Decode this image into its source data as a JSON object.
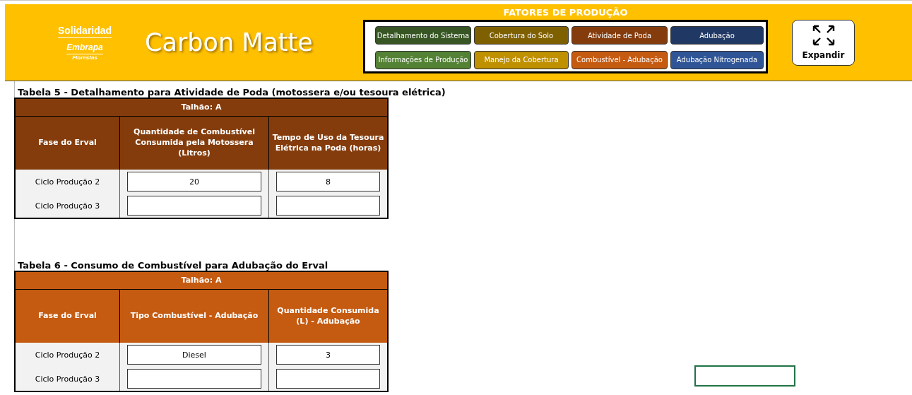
{
  "header": {
    "logo": {
      "top": "Solidaridad",
      "middle": "Embrapa",
      "bottom": "Florestas"
    },
    "title": "Carbon Matte",
    "nav": {
      "title": "FATORES DE PRODUÇÃO",
      "buttons": [
        {
          "label": "Detalhamento do Sistema",
          "color": "#375623"
        },
        {
          "label": "Cobertura do Solo",
          "color": "#7f6000"
        },
        {
          "label": "Atividade de Poda",
          "color": "#843c0c"
        },
        {
          "label": "Adubação",
          "color": "#203864"
        },
        {
          "label": "Informações de Produção",
          "color": "#548235"
        },
        {
          "label": "Manejo da Cobertura",
          "color": "#bf9000"
        },
        {
          "label": "Combustível - Adubação",
          "color": "#c55a11"
        },
        {
          "label": "Adubação Nitrogenada",
          "color": "#2f5597"
        }
      ]
    },
    "expand_button": {
      "label": "Expandir"
    }
  },
  "tables": [
    {
      "title": "Tabela 5 -  Detalhamento para Atividade de Poda (motossera e/ou tesoura elétrica)",
      "color": "#843c0c",
      "band": "Talhão: A",
      "columns": [
        "Fase do Erval",
        "Quantidade de Combustível Consumida pela Motossera (Litros)",
        "Tempo de Uso da Tesoura Elétrica na Poda (horas)"
      ],
      "rows": [
        {
          "phase": "Ciclo Produção 2",
          "fields": [
            "20",
            "8"
          ]
        },
        {
          "phase": "Ciclo Produção 3"
        }
      ]
    },
    {
      "title": "Tabela 6 - Consumo de Combustível para Adubação do Erval",
      "color": "#c55a11",
      "band": "Talhão: A",
      "columns": [
        "Fase do Erval",
        "Tipo Combustível - Adubação",
        "Quantidade Consumida (L) - Adubação"
      ],
      "rows": [
        {
          "phase": "Ciclo Produção 2",
          "fields": [
            "Diesel",
            "3"
          ]
        },
        {
          "phase": "Ciclo Produção 3"
        }
      ]
    }
  ]
}
